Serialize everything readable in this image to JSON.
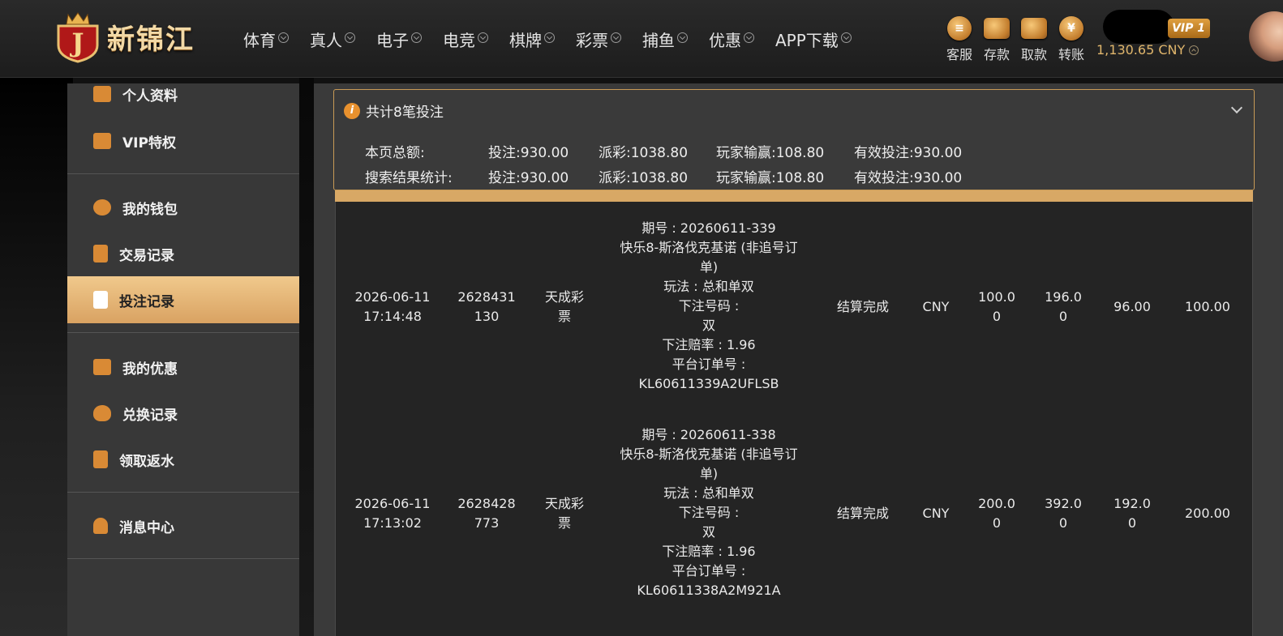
{
  "brand": {
    "name": "新锦江"
  },
  "nav": [
    "体育",
    "真人",
    "电子",
    "电竞",
    "棋牌",
    "彩票",
    "捕鱼",
    "优惠",
    "APP下载"
  ],
  "quick_actions": [
    {
      "label": "客服",
      "icon": "chat-icon"
    },
    {
      "label": "存款",
      "icon": "deposit-wallet-icon"
    },
    {
      "label": "取款",
      "icon": "withdraw-case-icon"
    },
    {
      "label": "转账",
      "icon": "transfer-coin-icon"
    }
  ],
  "user": {
    "vip": "VIP 1",
    "balance": "1,130.65 CNY"
  },
  "sidebar": {
    "items": [
      {
        "label": "个人资料",
        "icon": "profile-card-icon"
      },
      {
        "label": "VIP特权",
        "icon": "vip-card-icon"
      },
      {
        "label": "我的钱包",
        "icon": "piggy-bank-icon"
      },
      {
        "label": "交易记录",
        "icon": "document-list-icon"
      },
      {
        "label": "投注记录",
        "icon": "bet-record-icon"
      },
      {
        "label": "我的优惠",
        "icon": "gift-bag-icon"
      },
      {
        "label": "兑换记录",
        "icon": "money-bag-icon"
      },
      {
        "label": "领取返水",
        "icon": "rebate-doc-icon"
      },
      {
        "label": "消息中心",
        "icon": "bell-icon"
      }
    ],
    "active": "投注记录"
  },
  "summary": {
    "title": "共计8笔投注",
    "rows": [
      {
        "label": "本页总额:",
        "bet": "投注:930.00",
        "payout": "派彩:1038.80",
        "win": "玩家输赢:108.80",
        "valid": "有效投注:930.00"
      },
      {
        "label": "搜索结果统计:",
        "bet": "投注:930.00",
        "payout": "派彩:1038.80",
        "win": "玩家输赢:108.80",
        "valid": "有效投注:930.00"
      }
    ]
  },
  "records": [
    {
      "time": [
        "2026-06-11",
        "17:14:48"
      ],
      "id": [
        "2628431",
        "130"
      ],
      "platform": [
        "天成彩",
        "票"
      ],
      "detail": [
        "期号 : 20260611-339",
        "快乐8-斯洛伐克基诺 (非追号订",
        "单)",
        "玩法 : 总和单双",
        "下注号码 :",
        "双",
        "下注赔率 : 1.96",
        "平台订单号 :",
        "KL60611339A2UFLSB"
      ],
      "status": "结算完成",
      "currency": "CNY",
      "bet": [
        "100.0",
        "0"
      ],
      "payout": [
        "196.0",
        "0"
      ],
      "win": [
        "96.00"
      ],
      "valid": "100.00"
    },
    {
      "time": [
        "2026-06-11",
        "17:13:02"
      ],
      "id": [
        "2628428",
        "773"
      ],
      "platform": [
        "天成彩",
        "票"
      ],
      "detail": [
        "期号 : 20260611-338",
        "快乐8-斯洛伐克基诺 (非追号订",
        "单)",
        "玩法 : 总和单双",
        "下注号码 :",
        "双",
        "下注赔率 : 1.96",
        "平台订单号 :",
        "KL60611338A2M921A"
      ],
      "status": "结算完成",
      "currency": "CNY",
      "bet": [
        "200.0",
        "0"
      ],
      "payout": [
        "392.0",
        "0"
      ],
      "win": [
        "192.0",
        "0"
      ],
      "valid": "200.00"
    }
  ]
}
